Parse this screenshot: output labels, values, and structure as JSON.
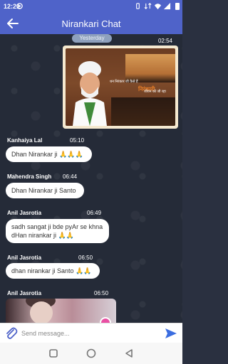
{
  "status_bar": {
    "time": "12:21"
  },
  "app_bar": {
    "title": "Nirankari Chat"
  },
  "chat": {
    "date_label": "Yesterday",
    "image_message": {
      "time": "02:54",
      "caption_small": "धन निरंकार जी कैसे हैं",
      "caption_brand": "निरंकारी",
      "caption_after": "जीवन को जी रहा"
    },
    "messages": [
      {
        "sender": "Kanhaiya Lal",
        "time": "05:10",
        "text": "Dhan Nirankar ji",
        "emoji": "🙏🙏🙏"
      },
      {
        "sender": "Mahendra Singh",
        "time": "06:44",
        "text": "Dhan Nirankar ji Santo",
        "emoji": ""
      },
      {
        "sender": "Anil Jasrotia",
        "time": "06:49",
        "text": "sadh sangat ji bde pyAr se khna dHan nirankar ji",
        "emoji": "🙏🙏"
      },
      {
        "sender": "Anil Jasrotia",
        "time": "06:50",
        "text": "dhan nirankar ji Santo",
        "emoji": "🙏🙏"
      },
      {
        "sender": "Anil Jasrotia",
        "time": "06:50",
        "text": "",
        "emoji": ""
      }
    ]
  },
  "input": {
    "placeholder": "Send message..."
  },
  "colors": {
    "primary": "#4f63c9",
    "send": "#3b6de0",
    "chat_bg": "#252b38",
    "bubble": "#ffffff"
  }
}
